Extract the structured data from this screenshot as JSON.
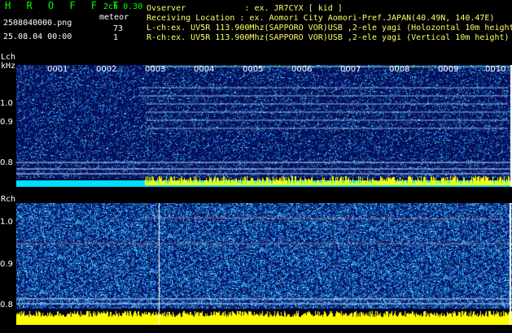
{
  "header": {
    "title": "H R O F F T",
    "version": "2ch 0.30",
    "filename": "2508040000.png",
    "meteor_label": "meteor",
    "datetime": "25.08.04 00:00",
    "count_l": "73",
    "count_r": "1",
    "observer": "Ovserver            : ex. JR7CYX [ kid ]",
    "location": "Receiving Location : ex. Aomori City Aomori-Pref.JAPAN(40.49N, 140.47E)",
    "lch_info": "L-ch:ex. UV5R 113.900Mhz(SAPPORO VOR)USB ,2-ele yagi (Holozontal 10m height)",
    "rch_info": "R-ch:ex. UV5R 113.900Mhz(SAPPORO VOR)USB ,2-ele yagi (Vertical 10m height)"
  },
  "lch": {
    "label": "Lch",
    "unit": "kHz",
    "ticks": [
      "1.0",
      "0.9",
      "0.8"
    ],
    "segments": [
      "0001",
      "0002",
      "0003",
      "0004",
      "0005",
      "0006",
      "0007",
      "0008",
      "0009",
      "0010"
    ]
  },
  "rch": {
    "label": "Rch",
    "ticks": [
      "1.0",
      "0.9",
      "0.8"
    ]
  },
  "colors": {
    "background": "#000000",
    "noise_dark": "#0a1a5a",
    "noise_light": "#3fa0ff",
    "signal": "#ffff00",
    "text_green": "#00ff00"
  }
}
